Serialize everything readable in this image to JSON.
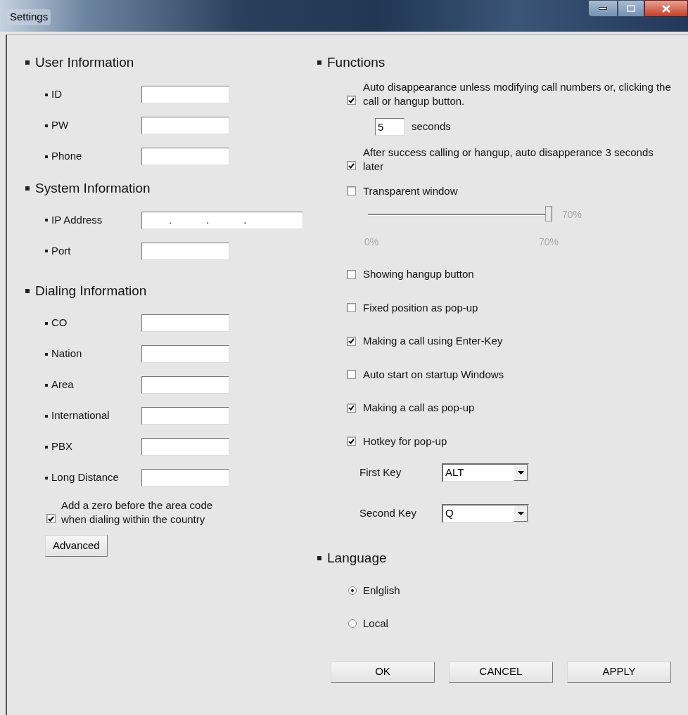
{
  "window": {
    "title": "Settings"
  },
  "user_information": {
    "title": "User Information",
    "fields": [
      {
        "label": "ID"
      },
      {
        "label": "PW"
      },
      {
        "label": "Phone"
      }
    ]
  },
  "system_information": {
    "title": "System Information",
    "fields": [
      {
        "label": "IP Address",
        "kind": "ip",
        "separators": [
          ".",
          ".",
          "."
        ]
      },
      {
        "label": "Port",
        "kind": "text"
      }
    ]
  },
  "dialing_information": {
    "title": "Dialing Information",
    "fields": [
      {
        "label": "CO"
      },
      {
        "label": "Nation"
      },
      {
        "label": "Area"
      },
      {
        "label": "International"
      },
      {
        "label": "PBX"
      },
      {
        "label": "Long Distance"
      }
    ],
    "add_zero": {
      "label": "Add a zero before the area code when dialing within the country",
      "checked": true
    },
    "advanced_button": "Advanced"
  },
  "functions": {
    "title": "Functions",
    "auto_disappear": {
      "label": "Auto disappearance unless modifying call numbers or, clicking the call or hangup button.",
      "checked": true,
      "seconds_value": "5",
      "seconds_label": "seconds"
    },
    "after_success": {
      "label": "After success calling or hangup, auto disapperance 3 seconds later",
      "checked": true
    },
    "transparent": {
      "label": "Transparent window",
      "checked": false,
      "slider": {
        "level": 1,
        "disabled": true,
        "value_label": "70%",
        "min_label": "0%",
        "max_label": "70%"
      }
    },
    "options": [
      {
        "label": "Showing hangup button",
        "checked": false
      },
      {
        "label": "Fixed position as pop-up",
        "checked": false
      },
      {
        "label": "Making a call using Enter-Key",
        "checked": true
      },
      {
        "label": "Auto start on startup Windows",
        "checked": false
      },
      {
        "label": "Making a call as pop-up",
        "checked": true
      },
      {
        "label": "Hotkey for pop-up",
        "checked": true
      }
    ],
    "hotkeys": [
      {
        "label": "First Key",
        "value": "ALT"
      },
      {
        "label": "Second Key",
        "value": "Q"
      }
    ]
  },
  "language": {
    "title": "Language",
    "options": [
      {
        "label": "Enlglish",
        "selected": true
      },
      {
        "label": "Local",
        "selected": false
      }
    ]
  },
  "buttons": [
    "OK",
    "CANCEL",
    "APPLY"
  ]
}
